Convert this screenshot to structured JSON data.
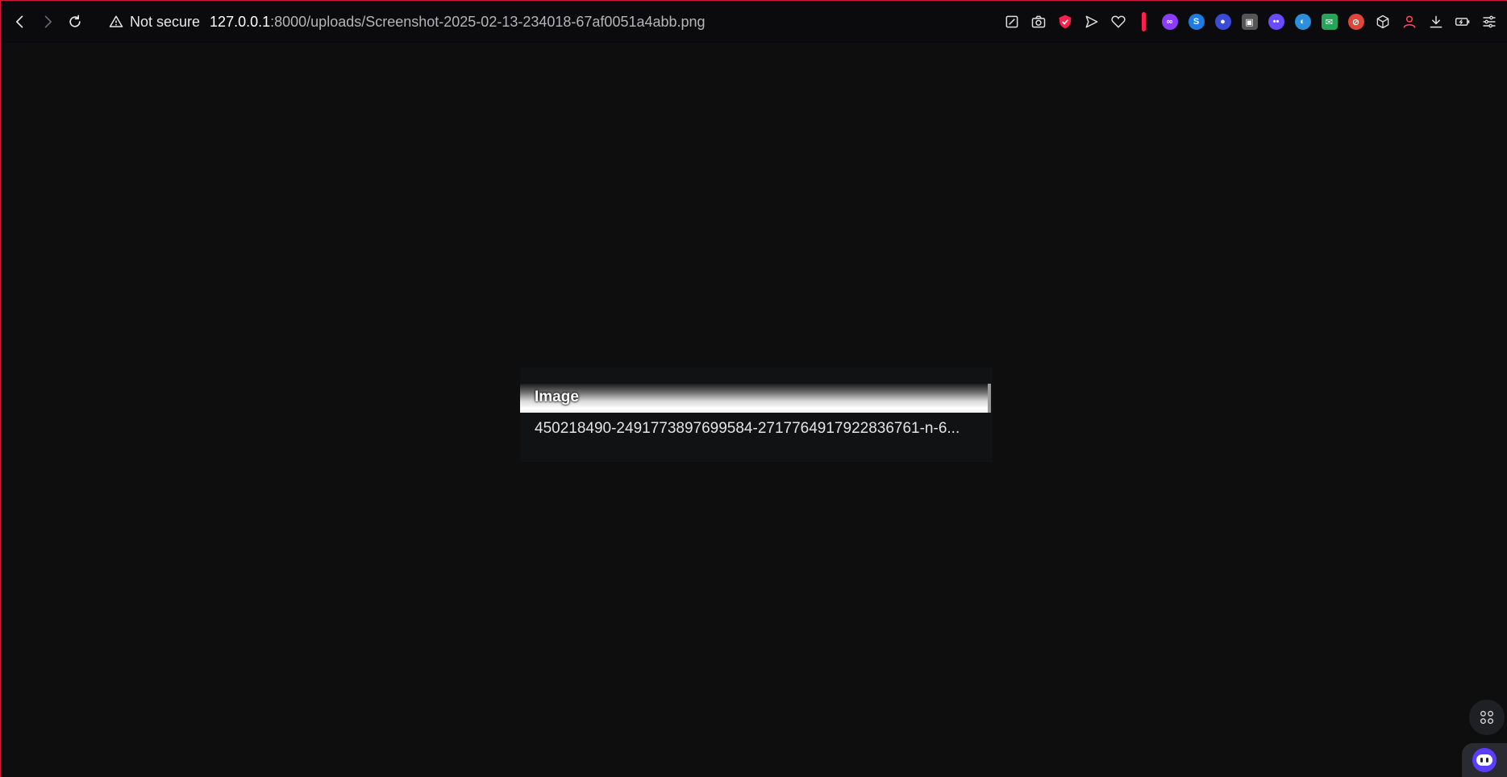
{
  "browser": {
    "security_label": "Not secure",
    "url_host": "127.0.0.1",
    "url_rest": ":8000/uploads/Screenshot-2025-02-13-234018-67af0051a4abb.png",
    "accent_color": "#ff1f4b"
  },
  "toolbar_icons": [
    "edit-icon",
    "camera-icon",
    "shield-check-icon",
    "send-icon",
    "heart-icon",
    "extension-purple-icon",
    "extension-blue-s-icon",
    "extension-alien-icon",
    "extension-gray-box-icon",
    "extension-face-icon",
    "extension-globe-icon",
    "extension-mail-icon",
    "extension-red-circle-icon",
    "cube-icon",
    "profile-icon",
    "download-icon",
    "battery-icon",
    "sliders-icon"
  ],
  "image_viewer": {
    "header": "Image",
    "filename": "450218490-2491773897699584-2717764917922836761-n-6..."
  }
}
